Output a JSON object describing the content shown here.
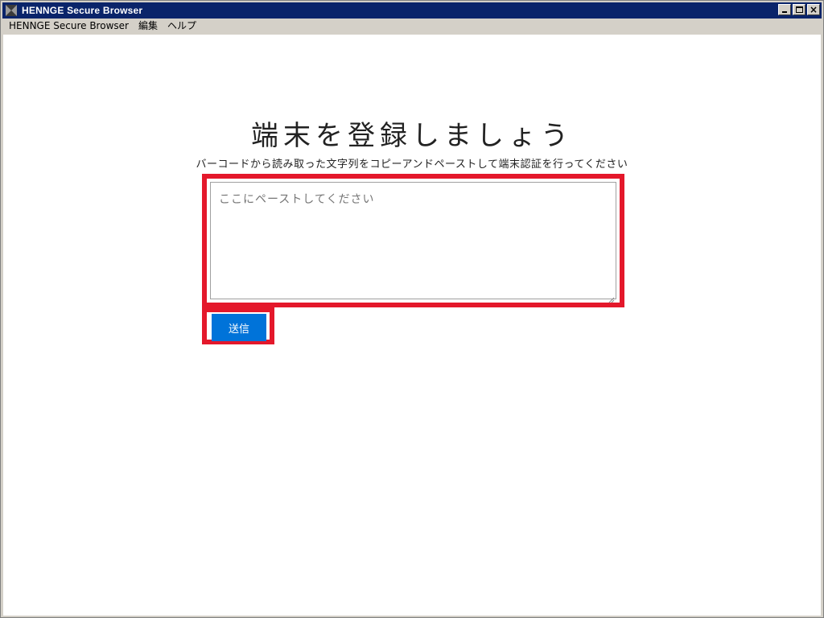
{
  "window": {
    "title": "HENNGE Secure Browser",
    "icon": "app-logo-icon"
  },
  "menubar": {
    "items": [
      {
        "label": "HENNGE Secure Browser"
      },
      {
        "label": "編集"
      },
      {
        "label": "ヘルプ"
      }
    ]
  },
  "main": {
    "title": "端末を登録しましょう",
    "subtitle": "バーコードから読み取った文字列をコピーアンドペーストして端末認証を行ってください",
    "textarea": {
      "placeholder": "ここにペーストしてください",
      "value": ""
    },
    "submit_label": "送信"
  },
  "colors": {
    "titlebar": "#0a246a",
    "highlight": "#e4182b",
    "button": "#0073d9"
  }
}
